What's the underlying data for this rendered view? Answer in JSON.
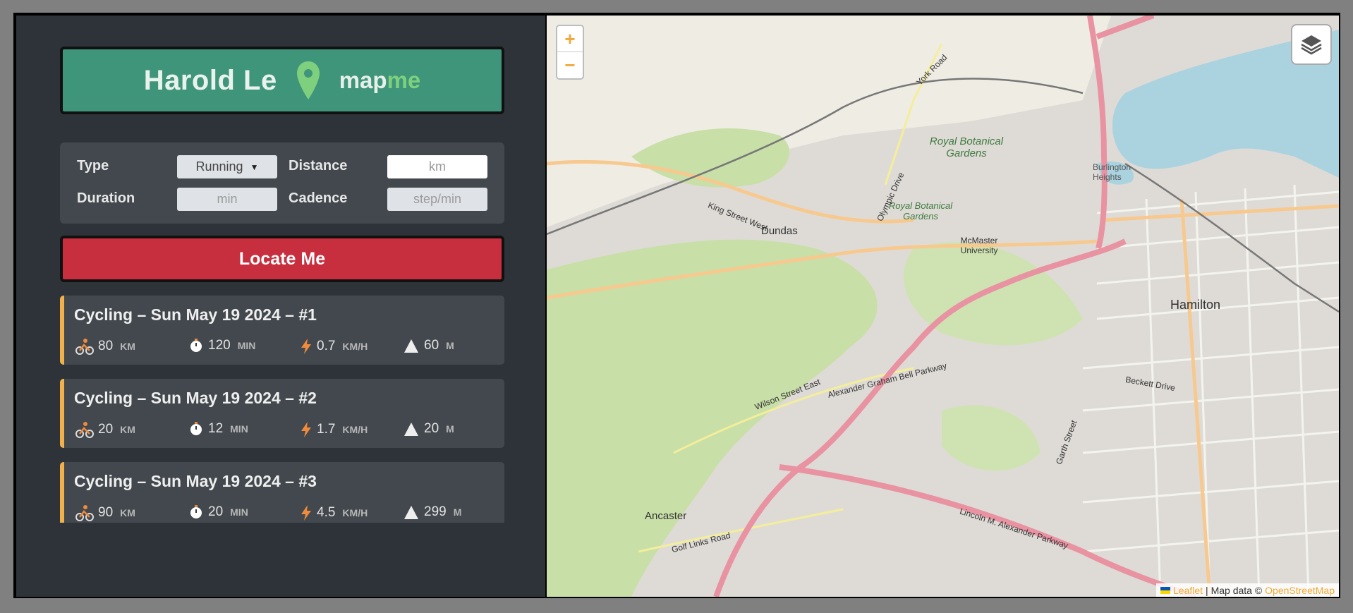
{
  "brand": {
    "name": "Harold Le",
    "word_part1": "map",
    "word_part2": "me"
  },
  "form": {
    "type_label": "Type",
    "type_value": "Running",
    "distance_label": "Distance",
    "distance_placeholder": "km",
    "duration_label": "Duration",
    "duration_placeholder": "min",
    "cadence_label": "Cadence",
    "cadence_placeholder": "step/min"
  },
  "locate_label": "Locate Me",
  "workouts": [
    {
      "title": "Cycling – Sun May 19 2024 – #1",
      "distance": "80",
      "distance_unit": "KM",
      "duration": "120",
      "duration_unit": "MIN",
      "speed": "0.7",
      "speed_unit": "KM/H",
      "elevation": "60",
      "elevation_unit": "M"
    },
    {
      "title": "Cycling – Sun May 19 2024 – #2",
      "distance": "20",
      "distance_unit": "KM",
      "duration": "12",
      "duration_unit": "MIN",
      "speed": "1.7",
      "speed_unit": "KM/H",
      "elevation": "20",
      "elevation_unit": "M"
    },
    {
      "title": "Cycling – Sun May 19 2024 – #3",
      "distance": "90",
      "distance_unit": "KM",
      "duration": "20",
      "duration_unit": "MIN",
      "speed": "4.5",
      "speed_unit": "KM/H",
      "elevation": "299",
      "elevation_unit": "M"
    }
  ],
  "map": {
    "zoom_in": "+",
    "zoom_out": "−",
    "attribution_leaflet": "Leaflet",
    "attribution_sep": "| Map data ©",
    "attribution_osm": "OpenStreetMap",
    "labels": {
      "hamilton": "Hamilton",
      "dundas": "Dundas",
      "ancaster": "Ancaster",
      "rbg1": "Royal Botanical Gardens",
      "rbg2": "Royal Botanical Gardens",
      "mcmaster": "McMaster University",
      "burlington": "Burlington Heights",
      "agb_parkway": "Alexander Graham Bell Parkway",
      "lincoln": "Lincoln M. Alexander Parkway",
      "king_st": "King Street West",
      "wilson_st": "Wilson Street East",
      "golf_links": "Golf Links Road",
      "york_rd": "York Road",
      "olympic": "Olympic Drive",
      "beckett": "Beckett Drive",
      "garth": "Garth Street"
    },
    "colors": {
      "water": "#aad3df",
      "park": "#c8dfa8",
      "highway": "#e892a2",
      "major_road": "#f7c98f",
      "urban": "#dedbd6"
    }
  },
  "colors": {
    "accent_green": "#3f957a",
    "accent_red": "#c82f3e",
    "card_border": "#f0b04c",
    "sidebar_bg": "#2d3338"
  }
}
